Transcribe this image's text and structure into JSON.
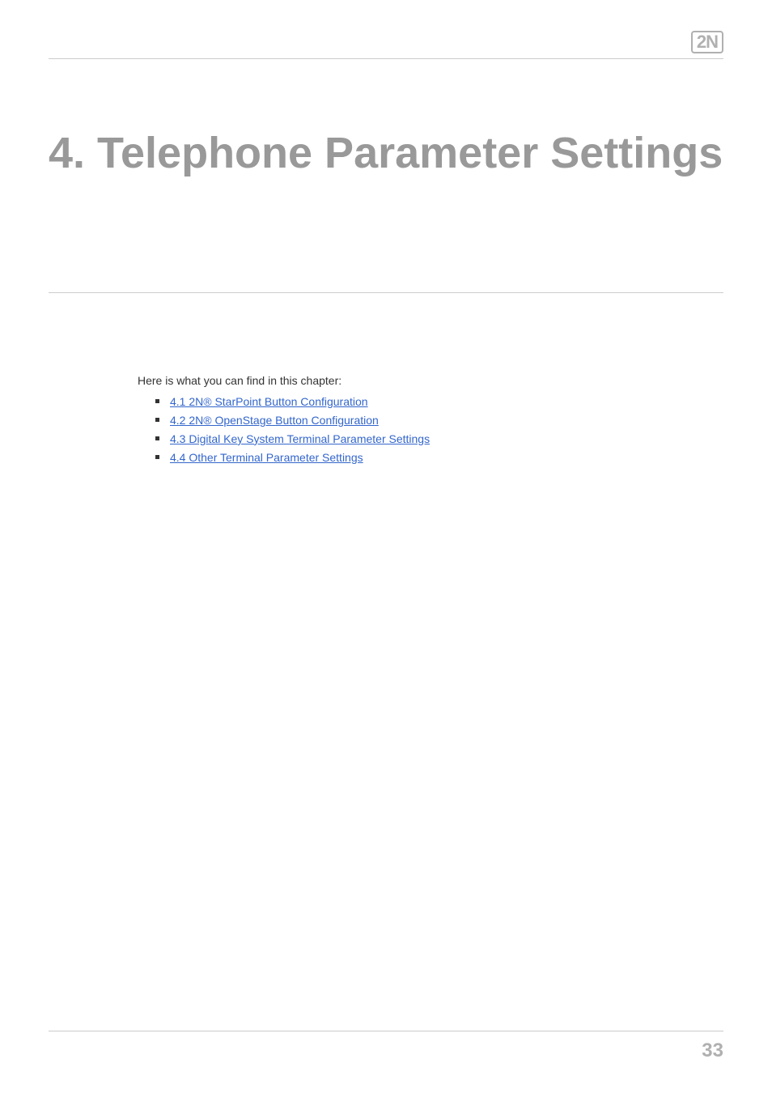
{
  "header": {
    "logo_text": "2N"
  },
  "title": "4. Telephone Parameter Settings",
  "intro": "Here is what you can find in this chapter:",
  "links": [
    {
      "text": "4.1 2N® StarPoint Button Configuration"
    },
    {
      "text": "4.2 2N® OpenStage Button Configuration"
    },
    {
      "text": "4.3 Digital Key System Terminal Parameter Settings"
    },
    {
      "text": "4.4 Other Terminal Parameter Settings"
    }
  ],
  "page_number": "33"
}
